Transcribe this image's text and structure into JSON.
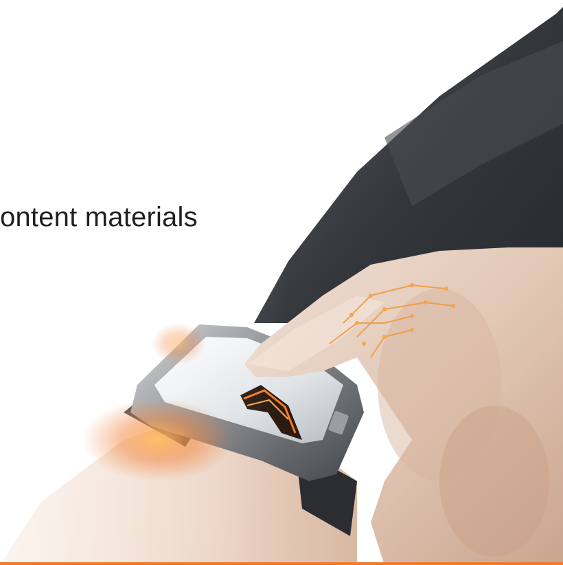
{
  "slide": {
    "text": "ontent materials"
  },
  "colors": {
    "accent": "#f07a2c",
    "sleeve": "#3c3f44",
    "background": "#ffffff"
  },
  "image": {
    "subject": "smartwatch-touch-photo"
  }
}
